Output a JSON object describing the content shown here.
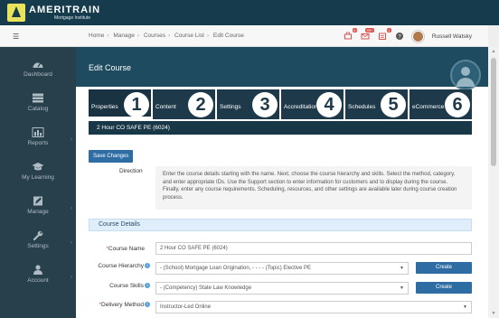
{
  "brand": {
    "name": "AMERITRAIN",
    "tagline": "Mortgage Institute"
  },
  "topbar": {
    "menu_icon": "menu-toggle-icon",
    "breadcrumb": [
      "Home",
      "Manage",
      "Courses",
      "Course List",
      "Edit Course"
    ],
    "notifications": {
      "cart_badge": "0",
      "messages_badge": "99+",
      "alerts_badge": "1"
    },
    "help_icon": "help-icon",
    "user_name": "Russell Watsky"
  },
  "sidebar": {
    "items": [
      {
        "label": "Dashboard",
        "icon": "speedometer-icon"
      },
      {
        "label": "Catalog",
        "icon": "catalog-icon"
      },
      {
        "label": "Reports",
        "icon": "bar-chart-icon"
      },
      {
        "label": "My Learning",
        "icon": "graduation-cap-icon"
      },
      {
        "label": "Manage",
        "icon": "edit-icon"
      },
      {
        "label": "Settings",
        "icon": "wrench-icon"
      },
      {
        "label": "Account",
        "icon": "user-icon"
      }
    ]
  },
  "page": {
    "title": "Edit Course",
    "steps": [
      {
        "label": "Properties",
        "number": "1"
      },
      {
        "label": "Content",
        "number": "2"
      },
      {
        "label": "Settings",
        "number": "3"
      },
      {
        "label": "Accreditation",
        "number": "4"
      },
      {
        "label": "Schedules",
        "number": "5"
      },
      {
        "label": "eCommerce",
        "number": "6"
      }
    ],
    "course_name_banner": "2 Hour CO SAFE PE (6024)",
    "save_button": "Save Changes",
    "direction_label": "Direction",
    "direction_text": "Enter the course details starting with the name. Next, choose the course hierarchy and skills. Select the method, category, and enter appropriate IDs. Use the Support section to enter information for customers and to display during the course. Finally, enter any course requirements. Scheduling, resources, and other settings are available later during course creation process.",
    "section_title": "Course Details",
    "form": {
      "course_name_label": "Course Name",
      "course_name_value": "2 Hour CO SAFE PE (6024)",
      "hierarchy_label": "Course Hierarchy",
      "hierarchy_value": "- (School) Mortgage Loan Origination, - - - - (Topic) Elective PE",
      "skills_label": "Course Skills",
      "skills_value": "- (Competency) State Law Knowledge",
      "delivery_label": "Delivery Method",
      "delivery_value": "Instructor-Led Online",
      "create_label": "Create"
    }
  }
}
